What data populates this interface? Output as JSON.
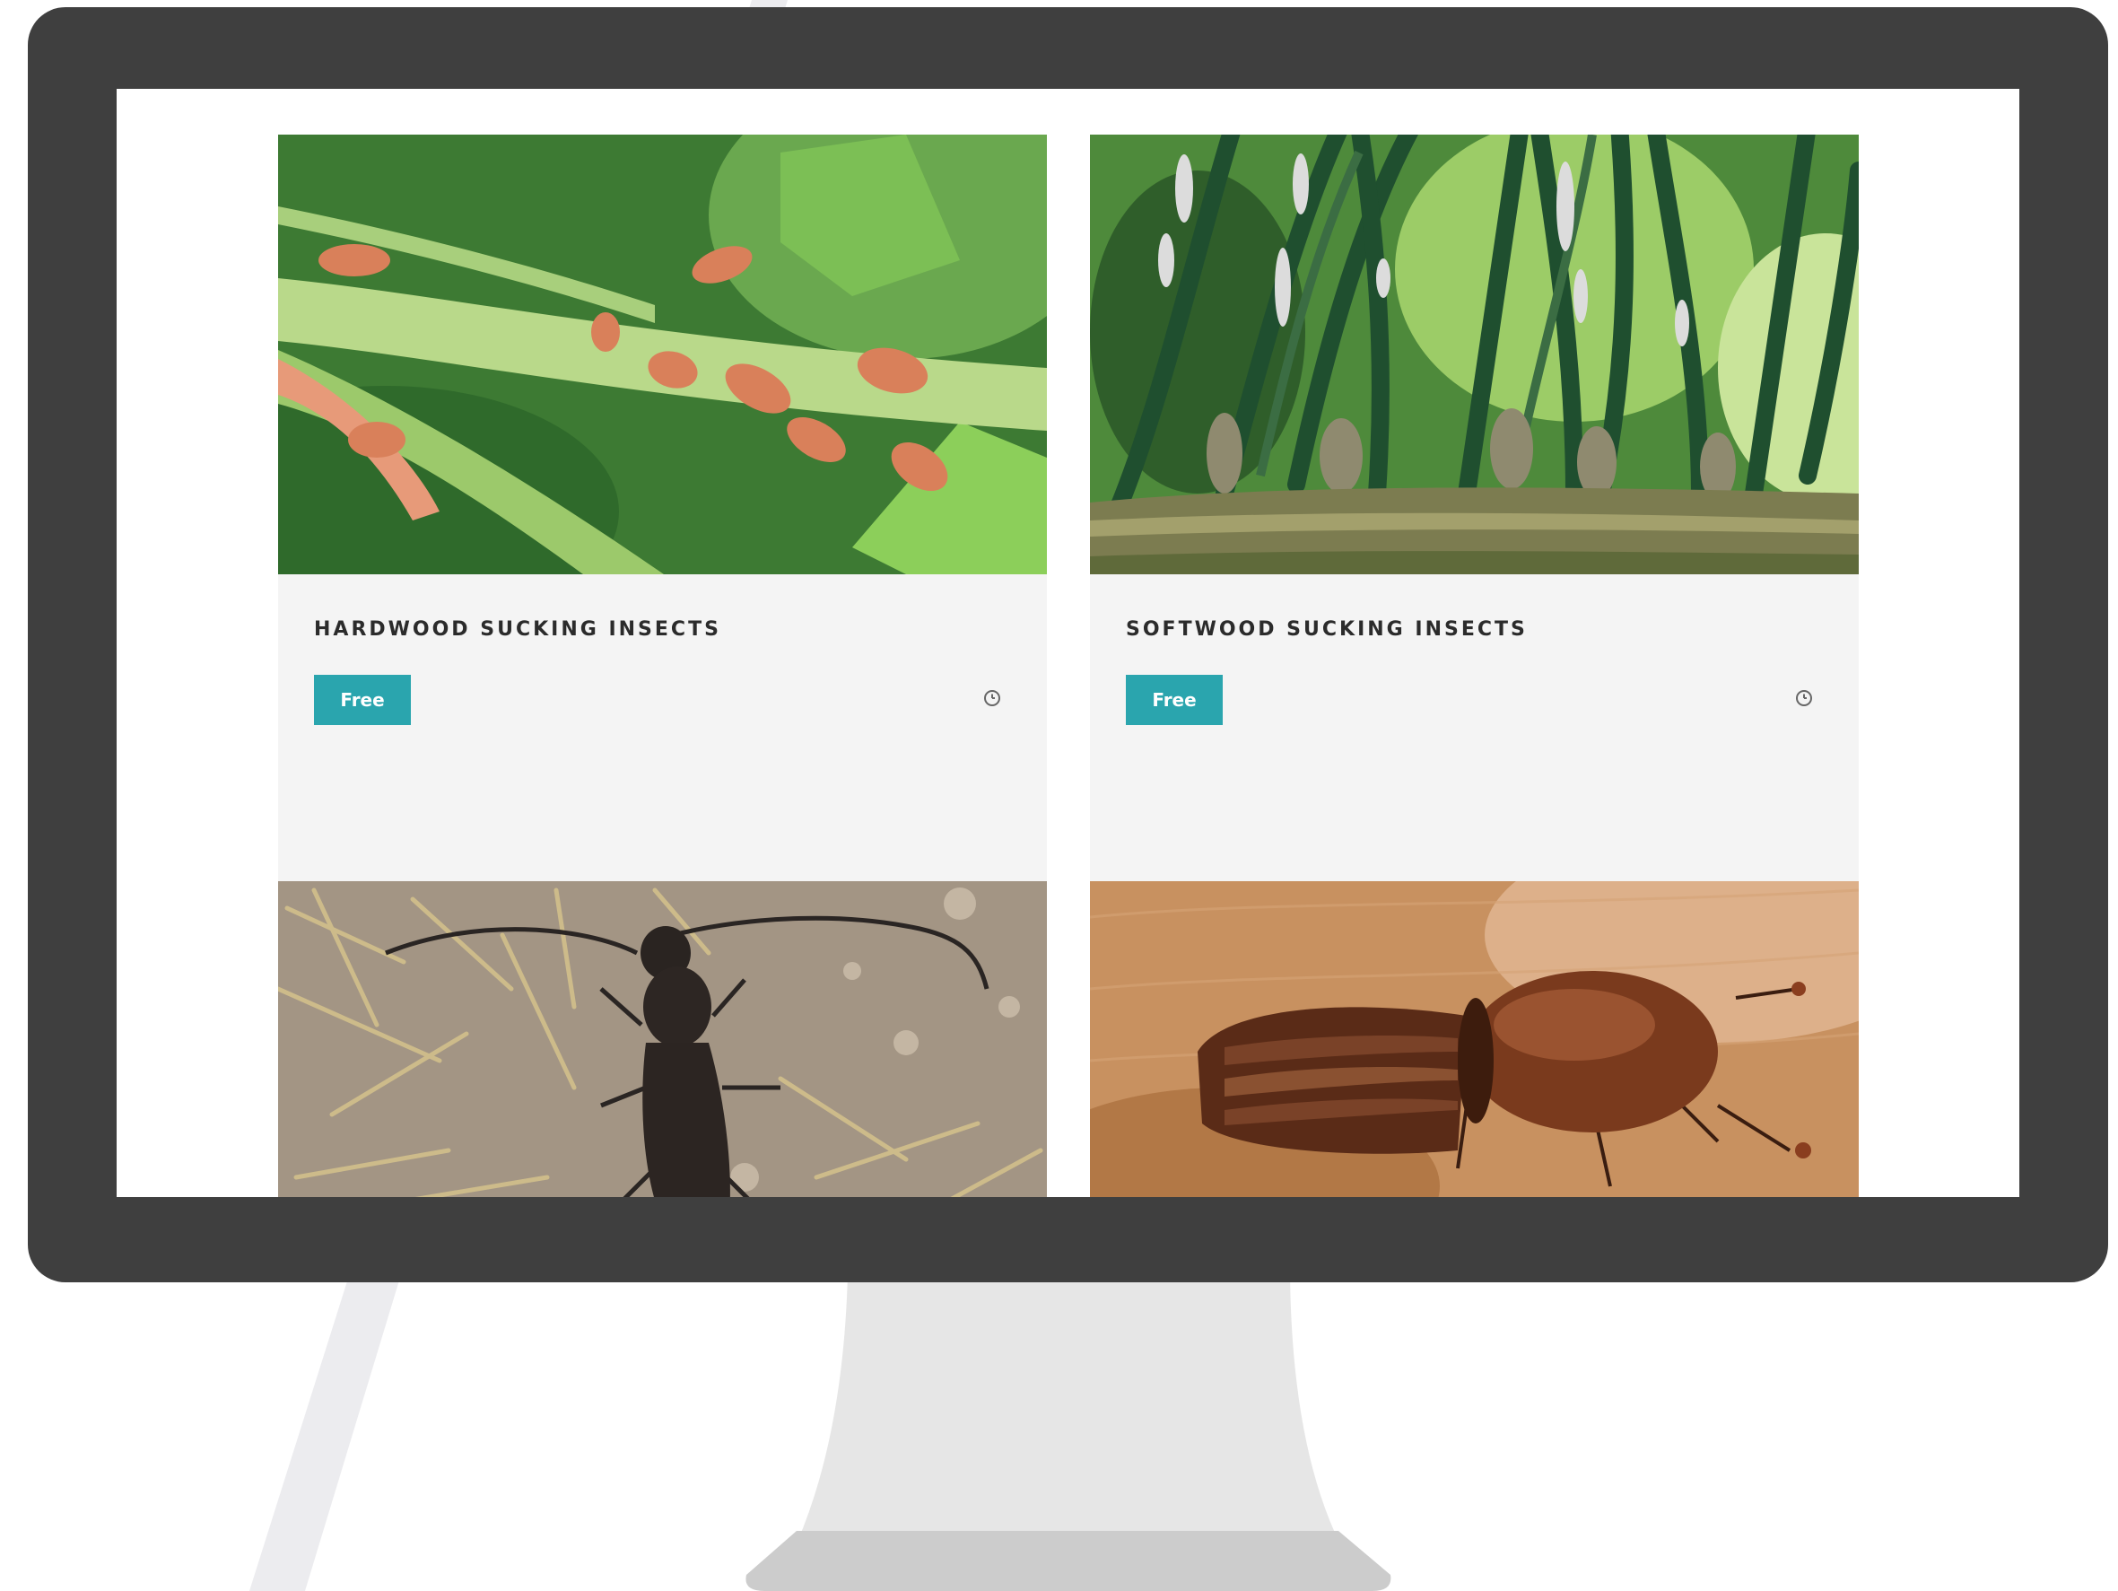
{
  "cards": [
    {
      "title": "HARDWOOD SUCKING INSECTS",
      "badge": "Free",
      "image": "aphids-on-stem-photo",
      "icon": "clock-icon"
    },
    {
      "title": "SOFTWOOD SUCKING INSECTS",
      "badge": "Free",
      "image": "pine-needles-adelgids-photo",
      "icon": "clock-icon"
    },
    {
      "title": "",
      "image": "longhorn-beetle-on-ground-photo"
    },
    {
      "title": "",
      "image": "bark-beetle-on-wood-photo"
    }
  ],
  "colors": {
    "bezel": "#3f3f3f",
    "stand": "#e6e6e6",
    "stand_base": "#cccccc",
    "accent": "#2aa5ae",
    "card_bg": "#f4f4f4",
    "card_border": "#5fb6bf"
  }
}
